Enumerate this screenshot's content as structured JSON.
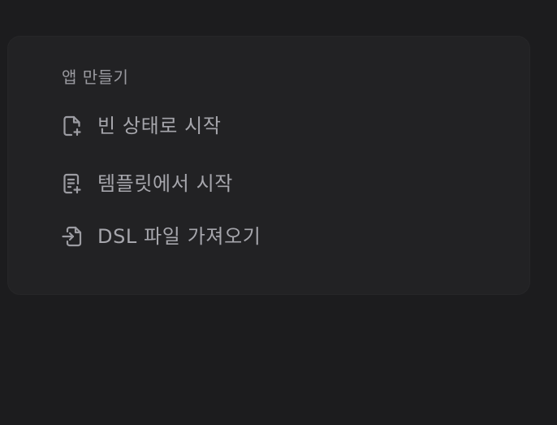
{
  "panel": {
    "title": "앱 만들기",
    "items": [
      {
        "label": "빈 상태로 시작",
        "icon": "file-plus-icon"
      },
      {
        "label": "템플릿에서 시작",
        "icon": "file-text-plus-icon"
      },
      {
        "label": "DSL 파일 가져오기",
        "icon": "file-import-icon"
      }
    ]
  },
  "colors": {
    "background": "#1c1c1e",
    "panel": "#222224",
    "text": "#a6a6ac"
  }
}
